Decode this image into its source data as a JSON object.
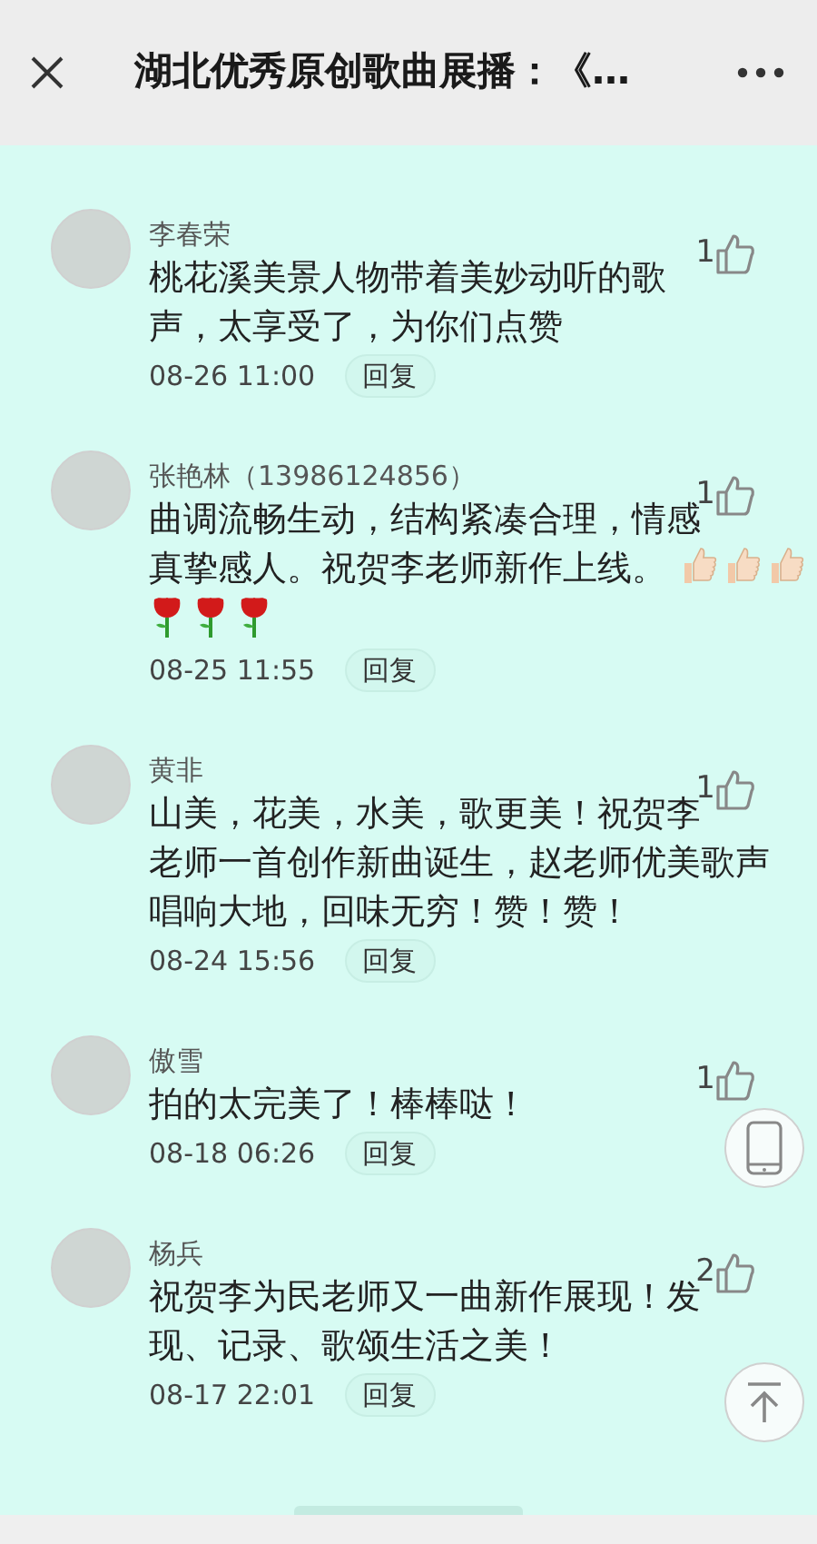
{
  "header": {
    "title": "湖北优秀原创歌曲展播：《…"
  },
  "comments": [
    {
      "name": "李春荣",
      "likes": "1",
      "lines": [
        "桃花溪美景人物带着美妙动听的歌",
        "声，太享受了，为你们点赞"
      ],
      "time": "08-26 11:00",
      "reply": "回复"
    },
    {
      "name": "张艳林（13986124856）",
      "likes": "1",
      "lines": [
        "曲调流畅生动，结构紧凑合理，情感",
        "真挚感人。祝贺李老师新作上线。"
      ],
      "inline_emoji": [
        {
          "kind": "thumbs-up"
        },
        {
          "kind": "thumbs-up"
        },
        {
          "kind": "thumbs-up"
        }
      ],
      "emoji_line": [
        {
          "kind": "rose"
        },
        {
          "kind": "rose"
        },
        {
          "kind": "rose"
        }
      ],
      "time": "08-25 11:55",
      "reply": "回复"
    },
    {
      "name": "黄非",
      "likes": "1",
      "lines": [
        "山美，花美，水美，歌更美！祝贺李",
        "老师一首创作新曲诞生，赵老师优美歌声",
        "唱响大地，回味无穷！赞！赞！"
      ],
      "time": "08-24 15:56",
      "reply": "回复"
    },
    {
      "name": "傲雪",
      "likes": "1",
      "lines": [
        "拍的太完美了！棒棒哒！"
      ],
      "time": "08-18 06:26",
      "reply": "回复"
    },
    {
      "name": "杨兵",
      "likes": "2",
      "lines": [
        "祝贺李为民老师又一曲新作展现！发",
        "现、记录、歌颂生活之美！"
      ],
      "time": "08-17 22:01",
      "reply": "回复"
    }
  ]
}
